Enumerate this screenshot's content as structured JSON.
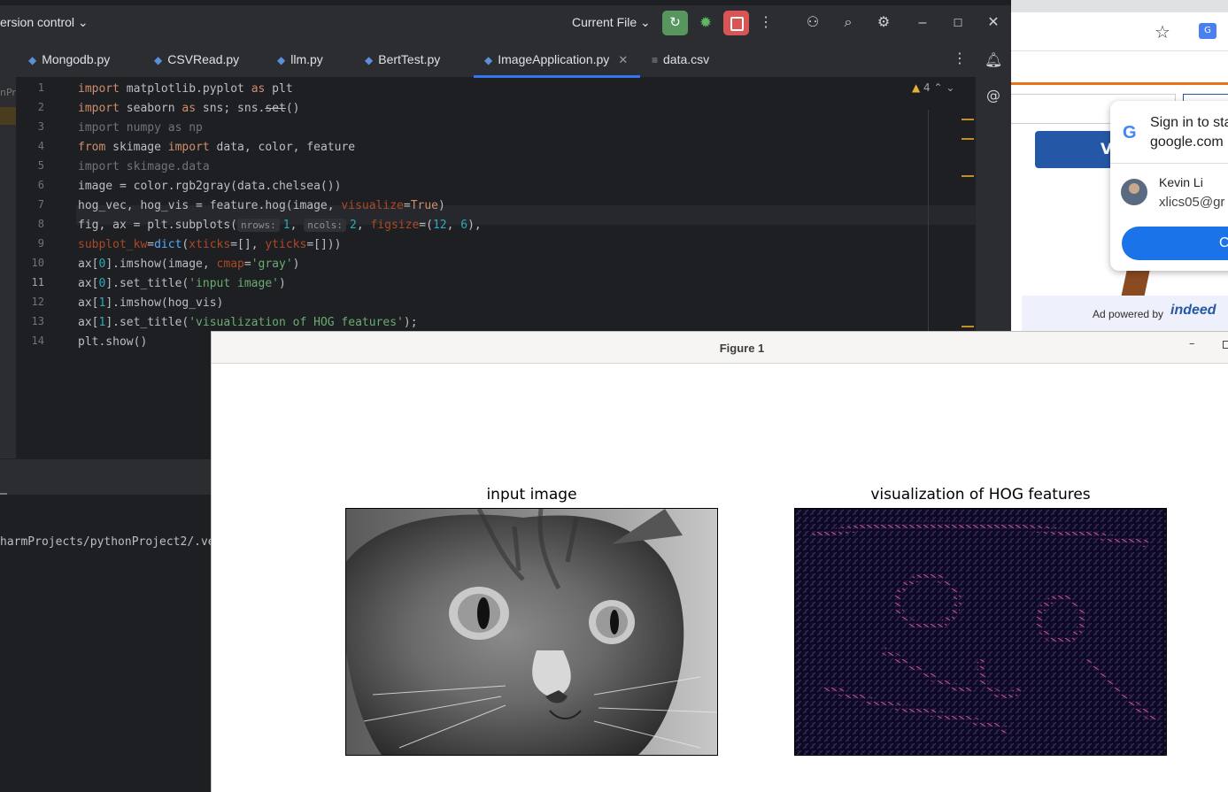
{
  "ide": {
    "version_control": "ersion control ⌄",
    "current_file": "Current File ⌄",
    "tabs": [
      {
        "label": "Mongodb.py"
      },
      {
        "label": "CSVRead.py"
      },
      {
        "label": "llm.py"
      },
      {
        "label": "BertTest.py"
      },
      {
        "label": "ImageApplication.py",
        "active": true
      },
      {
        "label": "data.csv"
      }
    ],
    "left_label": "nPr",
    "warnings_count": "4",
    "line_numbers": [
      "1",
      "2",
      "3",
      "4",
      "5",
      "6",
      "7",
      "8",
      "9",
      "10",
      "11",
      "12",
      "13",
      "14"
    ],
    "current_line": "11",
    "terminal_path": "harmProjects/pythonProject2/.ve",
    "hints": {
      "nrows": "nrows:",
      "ncols": "ncols:"
    },
    "code": {
      "l1": [
        "import",
        " matplotlib.pyplot ",
        "as",
        " plt"
      ],
      "l2": [
        "import",
        " seaborn ",
        "as",
        " sns; sns.",
        "set",
        "()"
      ],
      "l3": "import numpy as np",
      "l4": [
        "from",
        " skimage ",
        "import",
        " data, color, feature"
      ],
      "l5": "import skimage.data",
      "l6": "image = color.rgb2gray(data.chelsea())",
      "l7": [
        "hog_vec, hog_vis = feature.hog(image, ",
        "visualize",
        "=",
        "True",
        ")"
      ],
      "l8": [
        "fig, ax = plt.subplots(",
        "1",
        ", ",
        "2",
        ", ",
        "figsize",
        "=(",
        "12",
        ", ",
        "6",
        "),"
      ],
      "l9": [
        "subplot_kw",
        "=",
        "dict",
        "(",
        "xticks",
        "=[], ",
        "yticks",
        "=[]))"
      ],
      "l10": [
        "ax[",
        "0",
        "].imshow(image, ",
        "cmap",
        "=",
        "'gray'",
        ")"
      ],
      "l11": [
        "ax[",
        "0",
        "].set_title(",
        "'input image'",
        ")"
      ],
      "l12": [
        "ax[",
        "1",
        "].imshow(hog_vis)"
      ],
      "l13": [
        "ax[",
        "1",
        "].set_title(",
        "'visualization of HOG features'",
        ");"
      ],
      "l14": "plt.show()"
    }
  },
  "browser": {
    "button_partial": "V",
    "ad_text": "Ad powered by",
    "ad_logo": "indeed",
    "translate_label": "G",
    "google_popup": {
      "logo": "G",
      "title_line1": "Sign in to sta",
      "title_line2": "google.com",
      "name": "Kevin Li",
      "email": "xlics05@gr",
      "button": "C"
    }
  },
  "figure": {
    "window_title": "Figure 1",
    "left_title": "input image",
    "right_title": "visualization of HOG features"
  },
  "colors": {
    "ide_bg": "#1e1f22",
    "run_green": "#57965c",
    "stop_red": "#d95454",
    "indeed_blue": "#2557a7",
    "google_blue": "#1a73e8",
    "hog_magenta": "#d84fa0"
  }
}
